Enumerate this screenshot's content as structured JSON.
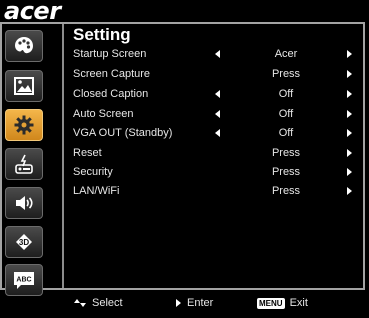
{
  "brand": "acer",
  "title": "Setting",
  "sidebar": {
    "items": [
      {
        "name": "palette-icon",
        "active": false
      },
      {
        "name": "image-icon",
        "active": false
      },
      {
        "name": "gear-icon",
        "active": true
      },
      {
        "name": "power-icon",
        "active": false
      },
      {
        "name": "speaker-icon",
        "active": false
      },
      {
        "name": "3d-icon",
        "active": false
      },
      {
        "name": "language-icon",
        "active": false
      }
    ],
    "language_label": "ABC",
    "threed_label": "3D"
  },
  "menu": {
    "rows": [
      {
        "label": "Startup Screen",
        "value": "Acer",
        "left_arrow": true
      },
      {
        "label": "Screen Capture",
        "value": "Press",
        "left_arrow": false
      },
      {
        "label": "Closed Caption",
        "value": "Off",
        "left_arrow": true
      },
      {
        "label": "Auto Screen",
        "value": "Off",
        "left_arrow": true
      },
      {
        "label": "VGA OUT (Standby)",
        "value": "Off",
        "left_arrow": true
      },
      {
        "label": "Reset",
        "value": "Press",
        "left_arrow": false
      },
      {
        "label": "Security",
        "value": "Press",
        "left_arrow": false
      },
      {
        "label": "LAN/WiFi",
        "value": "Press",
        "left_arrow": false
      }
    ]
  },
  "footer": {
    "select_label": "Select",
    "enter_label": "Enter",
    "menu_key": "MENU",
    "exit_label": "Exit"
  }
}
